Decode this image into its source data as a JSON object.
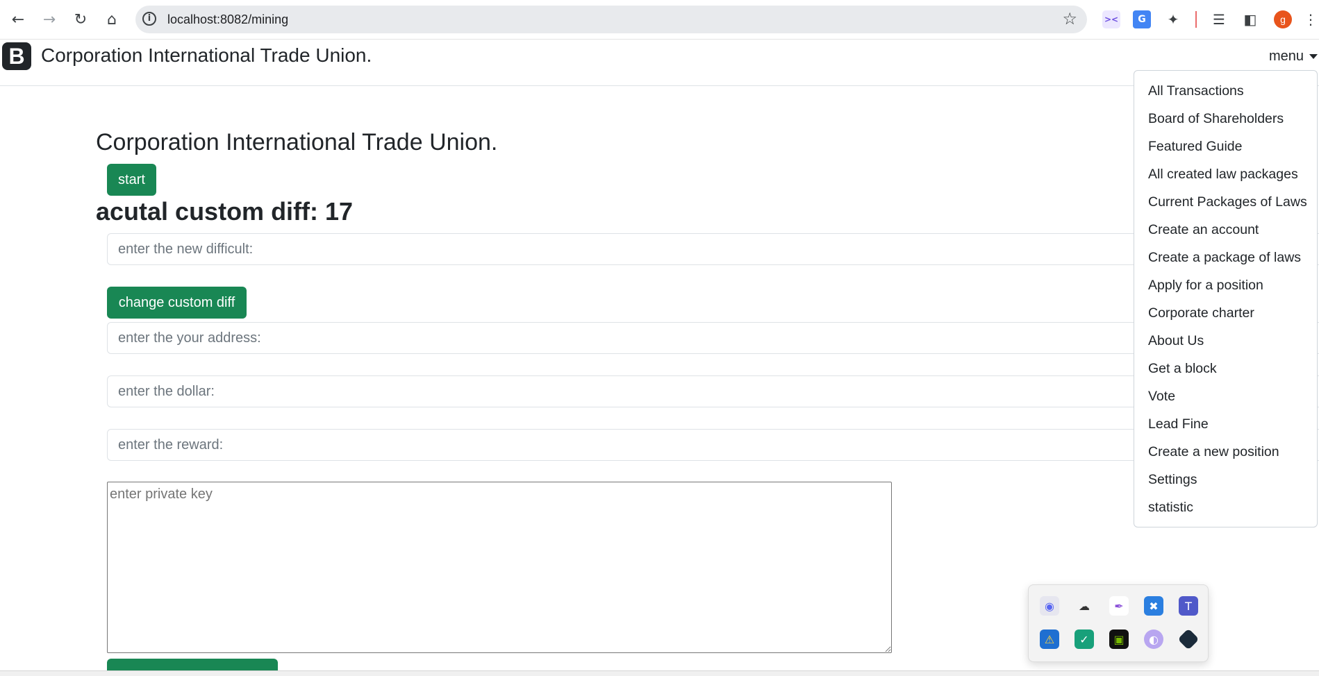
{
  "browser": {
    "url": "localhost:8082/mining",
    "profile_initial": "g",
    "icons": [
      "back-icon",
      "forward-icon",
      "reload-icon",
      "home-icon",
      "info-icon",
      "star-icon",
      "ai-extension-icon",
      "translate-icon",
      "puzzle-icon",
      "media-icon",
      "side-panel-icon",
      "kebab-menu-icon"
    ]
  },
  "navbar": {
    "logo": "B",
    "brand": "Corporation International Trade Union.",
    "menu_label": "menu"
  },
  "main": {
    "title": "Corporation International Trade Union.",
    "start_label": "start",
    "diff_heading": "acutal custom diff: 17",
    "difficulty_placeholder": "enter the new difficult:",
    "change_diff_label": "change custom diff",
    "address_placeholder": "enter the your address:",
    "dollar_placeholder": "enter the dollar:",
    "reward_placeholder": "enter the reward:",
    "private_key_placeholder": "enter private key"
  },
  "dropdown": {
    "items": [
      "All Transactions",
      "Board of Shareholders",
      "Featured Guide",
      "All created law packages",
      "Current Packages of Laws",
      "Create an account",
      "Create a package of laws",
      "Apply for a position",
      "Corporate charter",
      "About Us",
      "Get a block",
      "Vote",
      "Lead Fine",
      "Create a new position",
      "Settings",
      "statistic"
    ]
  },
  "tray": {
    "icons": [
      "discord-icon",
      "onedrive-icon",
      "feather-icon",
      "security-icon",
      "teams-icon",
      "defender-warning-icon",
      "shield-icon",
      "nvidia-icon",
      "browser-icon",
      "diamond-icon"
    ]
  },
  "colors": {
    "success": "#198754",
    "profile": "#e8541c"
  }
}
